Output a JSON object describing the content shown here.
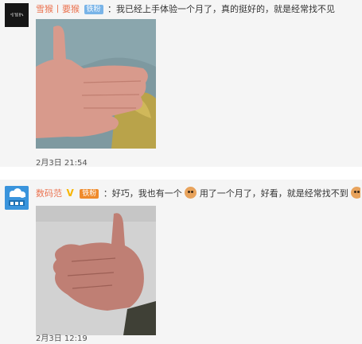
{
  "comments": [
    {
      "username": "雪猴丨要猴",
      "badge": "铁粉",
      "text": "：我已经上手体验一个月了，真的挺好的，就是经常找不见",
      "timestamp": "2月3日 21:54",
      "photo_icon": "hand-photo",
      "colors": {
        "username": "#eb7350",
        "badge": "#79b4e8"
      }
    },
    {
      "username": "数码范",
      "verified_mark": "V",
      "badge": "铁粉",
      "text_1": "：好巧，我也有一个",
      "text_2": "用了一个月了，好看，就是经常找不到",
      "timestamp": "2月3日 12:19",
      "photo_icon": "hand-thumbs-up-photo",
      "emoji_icon": "cat-face-emoji",
      "colors": {
        "username": "#eb7350",
        "badge": "#ef8b2c",
        "verified": "#f7b500"
      }
    }
  ]
}
